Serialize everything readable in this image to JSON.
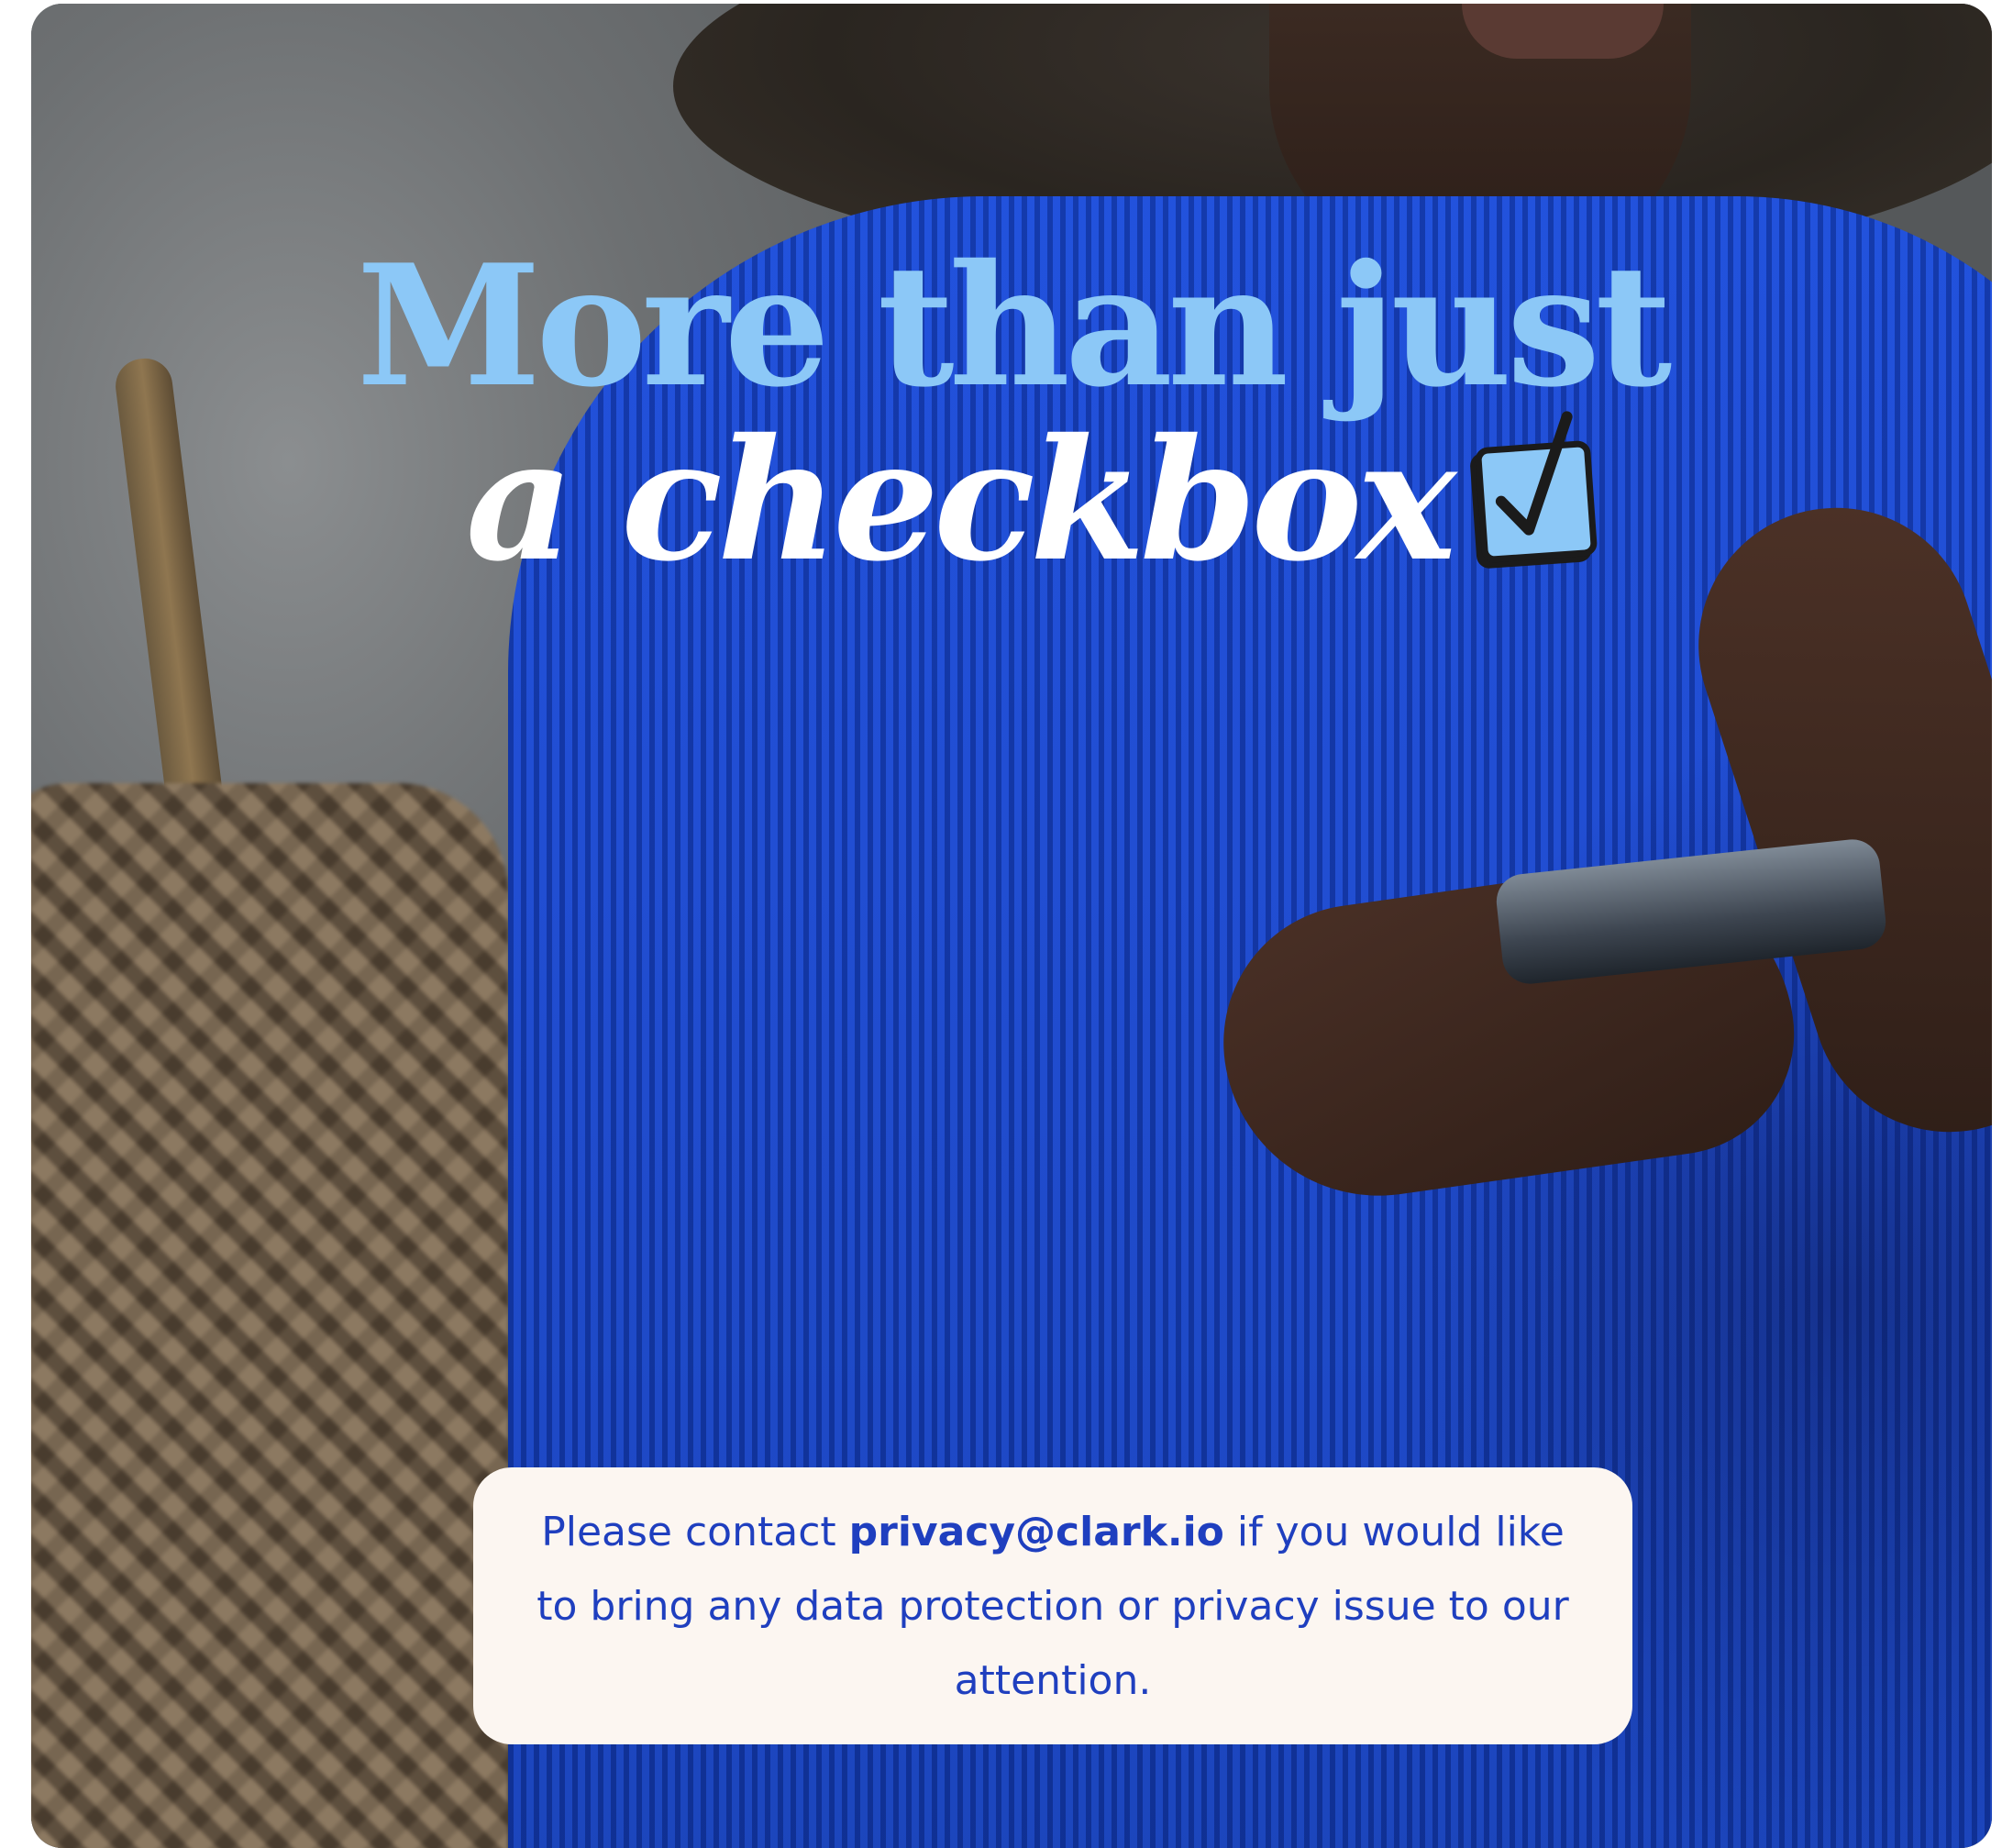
{
  "hero": {
    "headline_line1": "More than just",
    "headline_line2": "a checkbox",
    "checkbox_icon": "checkbox-checked-icon",
    "colors": {
      "headline_line1": "#8cc8f7",
      "headline_line2": "#ffffff",
      "sweater_blue": "#1e4ed8"
    }
  },
  "privacy_note": {
    "text_before": "Please contact ",
    "email_link": "privacy@clark.io",
    "text_after": " if you would like to bring any data protection or privacy issue to our attention.",
    "background": "#fcf6f1",
    "text_color": "#1f3fbf"
  }
}
